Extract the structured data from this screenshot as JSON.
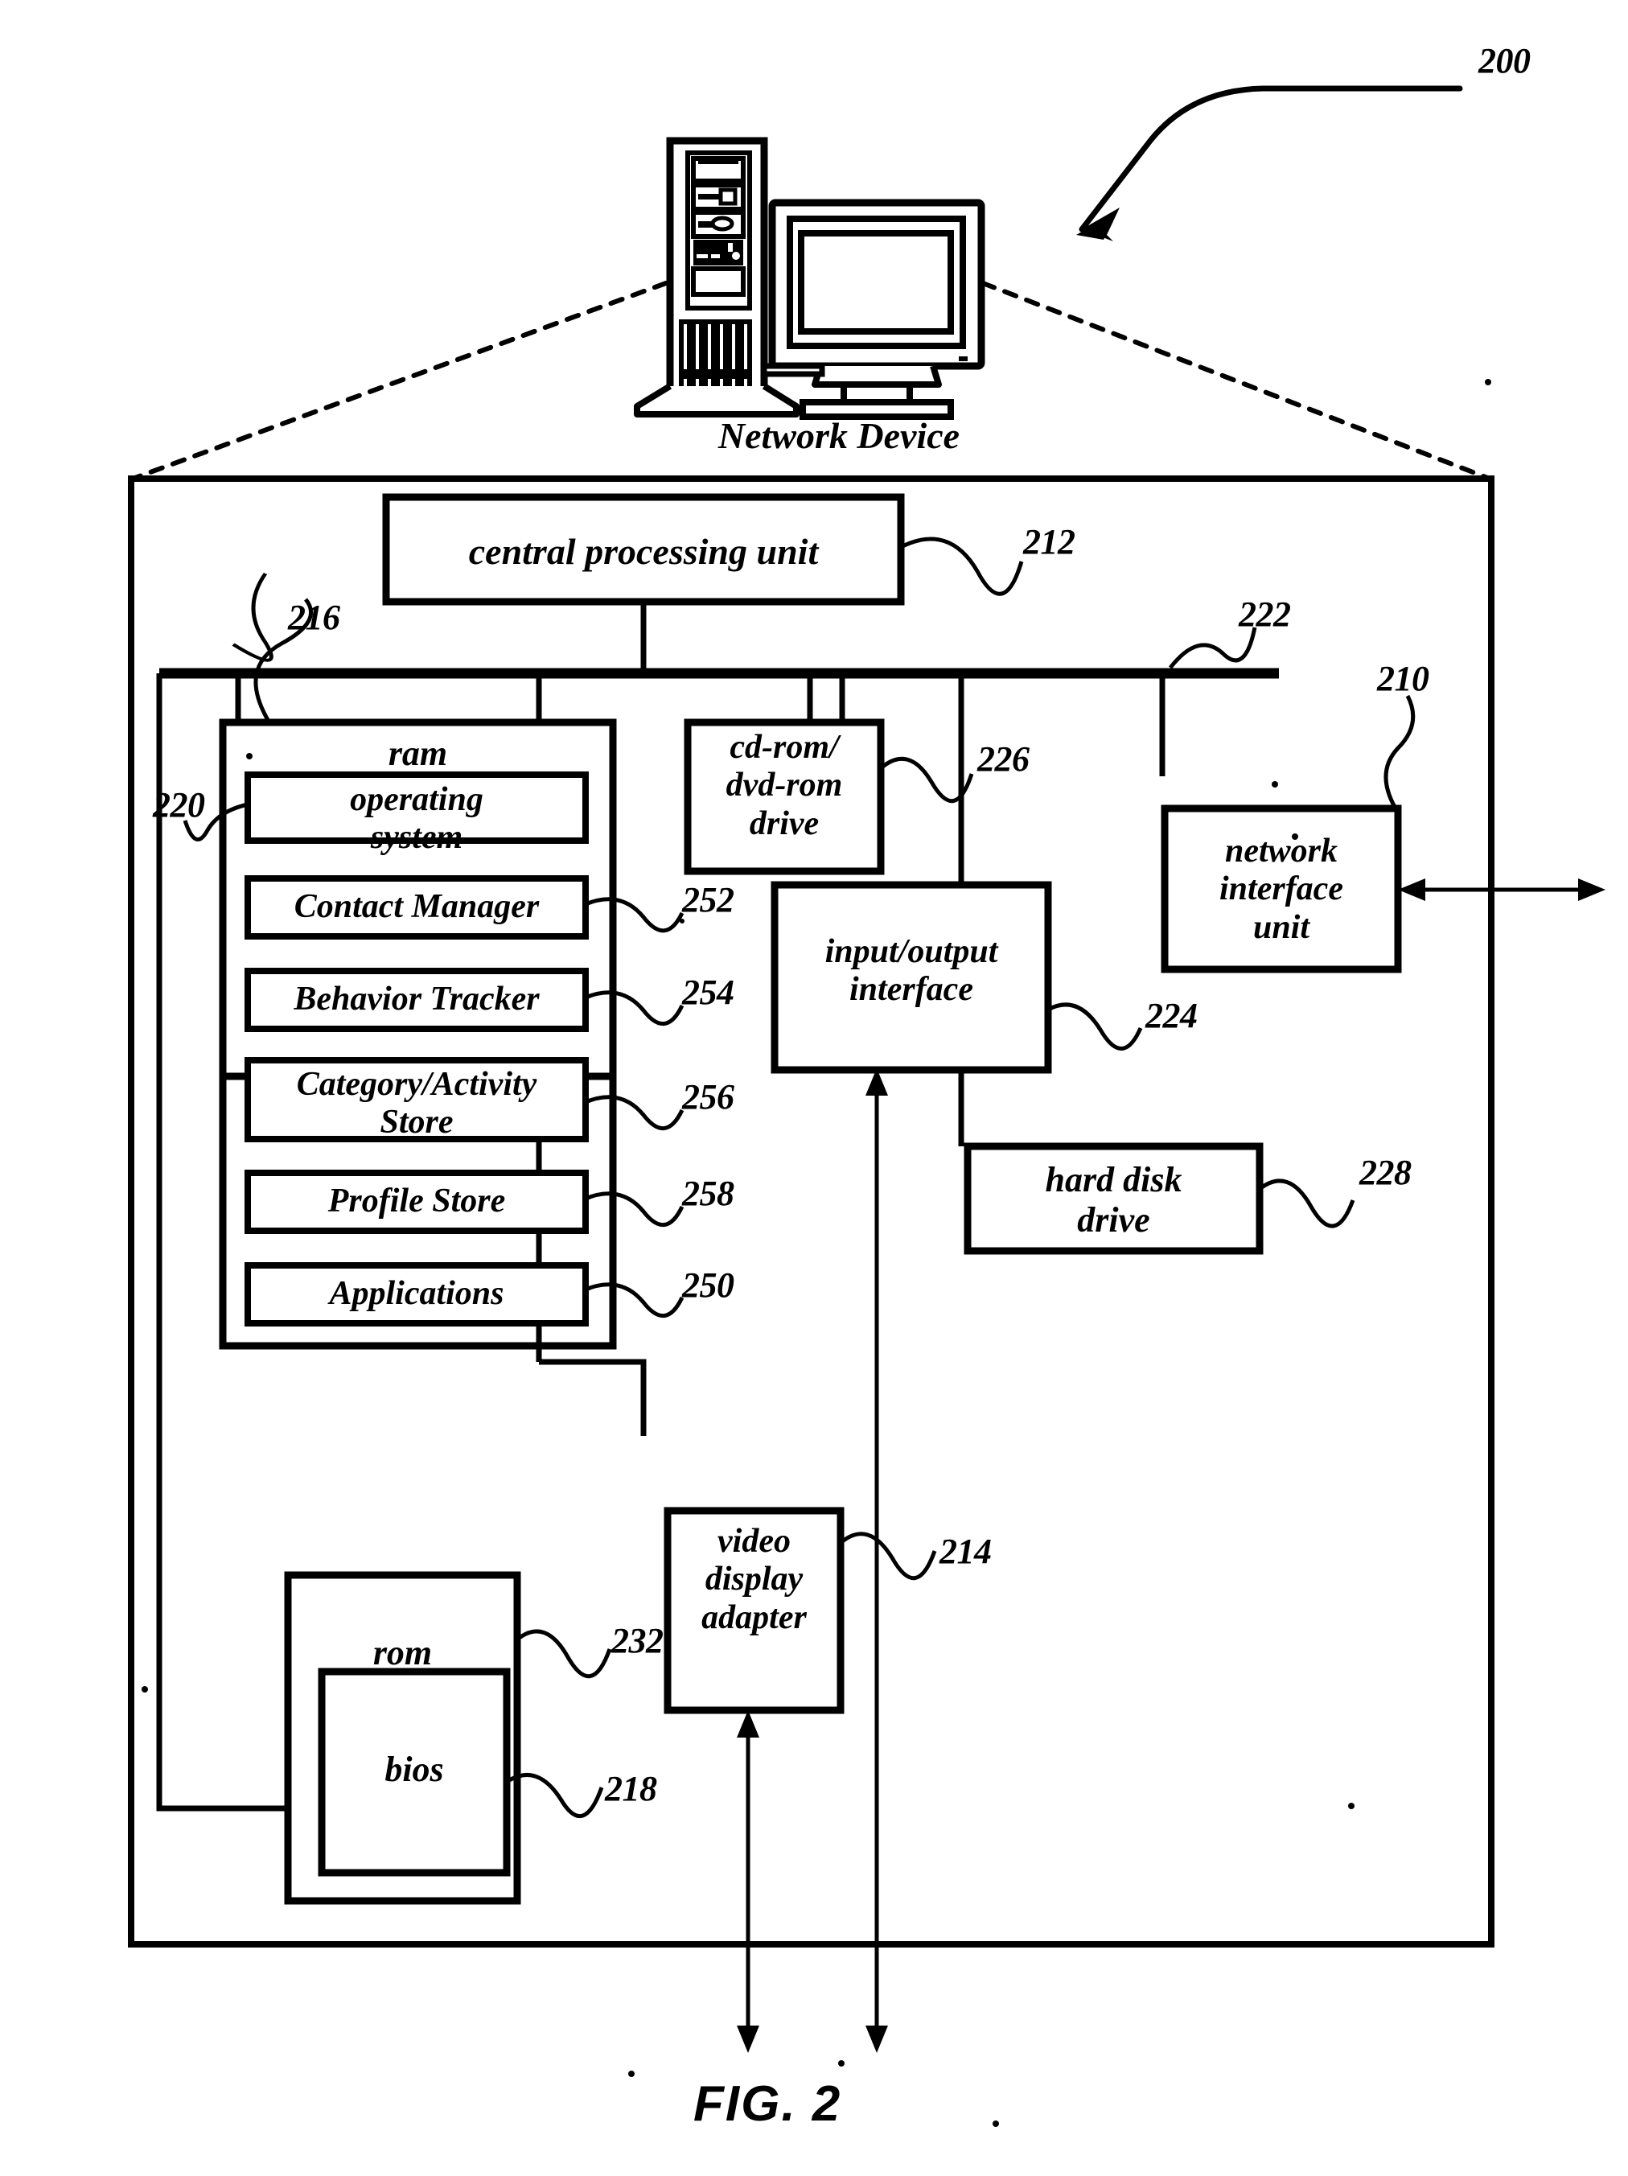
{
  "figure": {
    "caption": "FIG. 2",
    "system_ref": "200",
    "device_caption": "Network Device"
  },
  "blocks": {
    "cpu": {
      "label": "central processing unit",
      "ref": "212"
    },
    "ram": {
      "label": "ram",
      "ref": "216"
    },
    "operating_system": {
      "label": "operating\nsystem",
      "ref": "220"
    },
    "contact_manager": {
      "label": "Contact Manager",
      "ref": "252"
    },
    "behavior_tracker": {
      "label": "Behavior Tracker",
      "ref": "254"
    },
    "category_activity_store": {
      "label": "Category/Activity\nStore",
      "ref": "256"
    },
    "profile_store": {
      "label": "Profile Store",
      "ref": "258"
    },
    "applications": {
      "label": "Applications",
      "ref": "250"
    },
    "cdrom_drive": {
      "label": "cd-rom/\ndvd-rom\ndrive",
      "ref": "226"
    },
    "io_interface": {
      "label": "input/output\ninterface",
      "ref": "224"
    },
    "network_interface_unit": {
      "label": "network\ninterface\nunit",
      "ref": "210"
    },
    "hard_disk_drive": {
      "label": "hard disk\ndrive",
      "ref": "228"
    },
    "video_display_adapter": {
      "label": "video\ndisplay\nadapter",
      "ref": "214"
    },
    "rom": {
      "label": "rom",
      "ref": "232"
    },
    "bios": {
      "label": "bios",
      "ref": "218"
    },
    "bus": {
      "ref": "222"
    }
  },
  "colors": {
    "ink": "#000000",
    "background": "#ffffff"
  }
}
